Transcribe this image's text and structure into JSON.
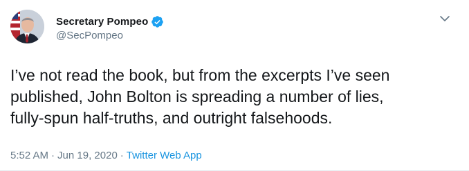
{
  "tweet": {
    "author": {
      "display_name": "Secretary Pompeo",
      "handle": "@SecPompeo",
      "verified": true
    },
    "text": "I’ve not read the book, but from the excerpts I’ve seen\npublished, John Bolton is spreading a number of lies,\nfully-spun half-truths, and outright falsehoods.",
    "time": "5:52 AM",
    "date": "Jun 19, 2020",
    "separator": "·",
    "source": "Twitter Web App"
  },
  "icons": {
    "verified": "verified-badge-icon",
    "menu": "chevron-down-icon"
  },
  "colors": {
    "text_primary": "#14171a",
    "text_secondary": "#657786",
    "link_blue": "#1b95e0",
    "verified_blue": "#1da1f2"
  }
}
